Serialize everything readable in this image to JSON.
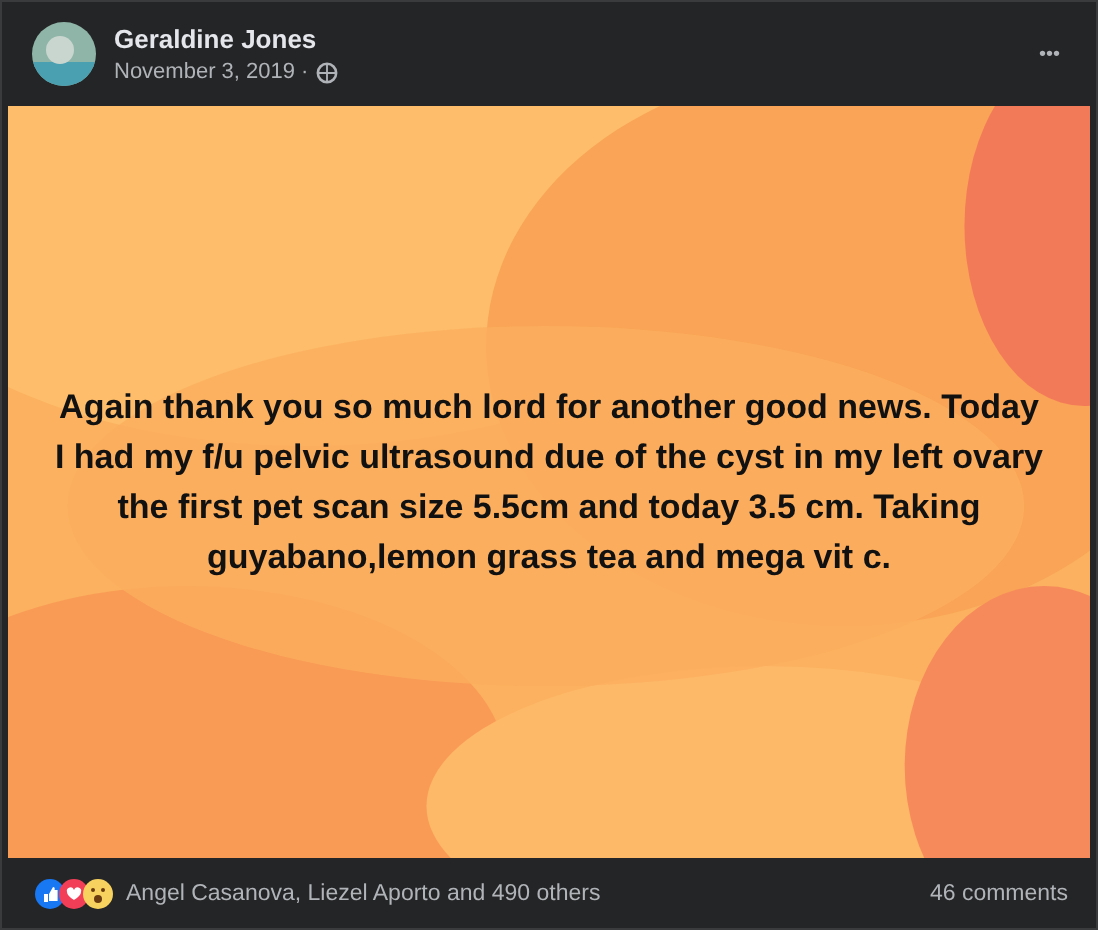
{
  "post": {
    "author": "Geraldine Jones",
    "date": "November 3, 2019 ·",
    "menu": "•••",
    "text": "Again thank you so much lord for another good news. Today I had my f/u pelvic ultrasound due of the cyst in my left ovary the first pet scan size 5.5cm and today 3.5 cm. Taking guyabano,lemon grass tea and mega vit c.",
    "reactions": "Angel Casanova, Liezel Aporto and 490 others",
    "comments": "46 comments"
  }
}
